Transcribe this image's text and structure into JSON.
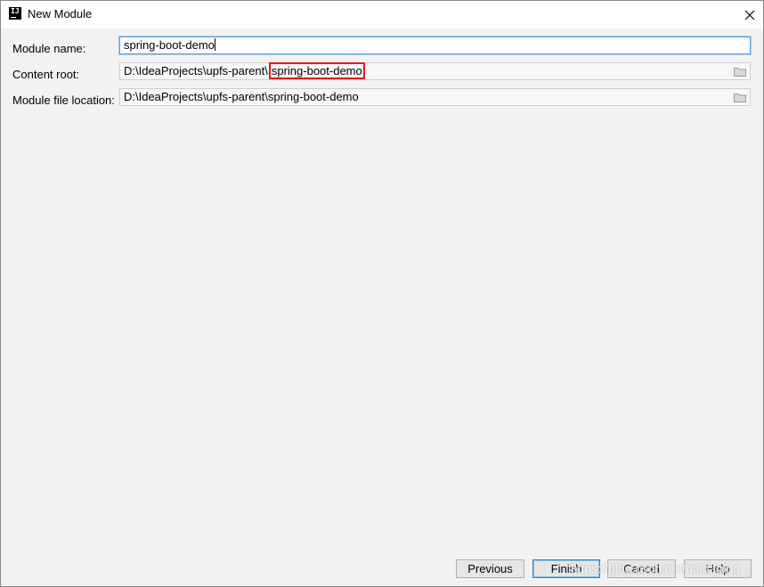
{
  "window": {
    "title": "New Module"
  },
  "form": {
    "module_name": {
      "label": "Module name:",
      "value": "spring-boot-demo"
    },
    "content_root": {
      "label": "Content root:",
      "prefix": "D:\\IdeaProjects\\upfs-parent\\",
      "highlight": "spring-boot-demo"
    },
    "module_file_location": {
      "label": "Module file location:",
      "value": "D:\\IdeaProjects\\upfs-parent\\spring-boot-demo"
    }
  },
  "buttons": {
    "previous": "Previous",
    "finish": "Finish",
    "cancel": "Cancel",
    "help": "Help"
  },
  "watermark": "https://blog.csdn.net/haidaping",
  "colors": {
    "highlight_box": "#e01b1b",
    "focus_border": "#5e9bd6"
  }
}
